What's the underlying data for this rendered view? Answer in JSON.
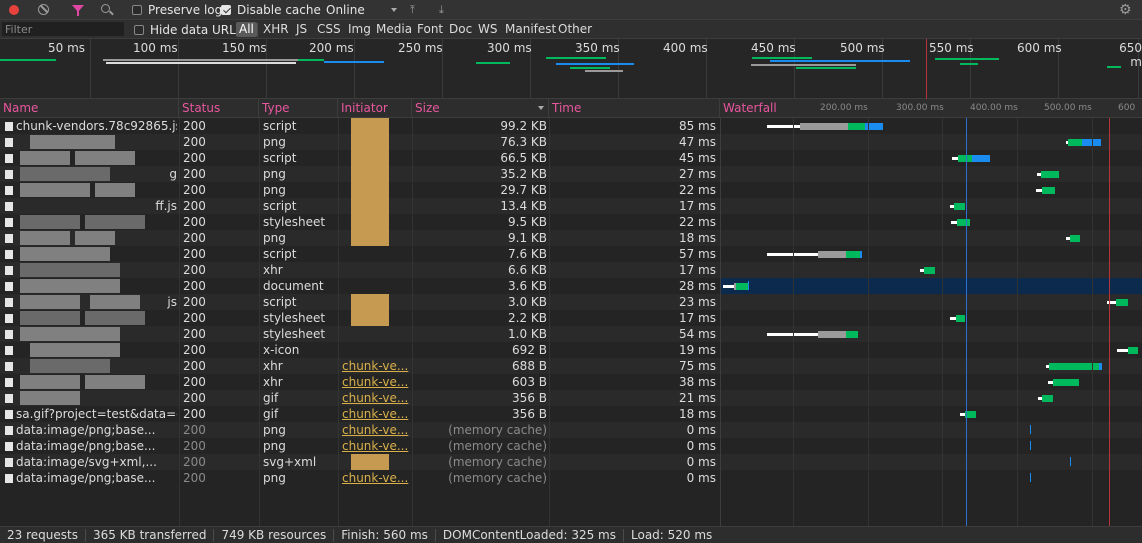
{
  "toolbar": {
    "preserve_log": "Preserve log",
    "disable_cache": "Disable cache",
    "throttle": "Online"
  },
  "filter": {
    "placeholder": "Filter",
    "hide_data_urls": "Hide data URLs",
    "types": [
      "All",
      "XHR",
      "JS",
      "CSS",
      "Img",
      "Media",
      "Font",
      "Doc",
      "WS",
      "Manifest",
      "Other"
    ]
  },
  "overview_ticks": [
    "50 ms",
    "100 ms",
    "150 ms",
    "200 ms",
    "250 ms",
    "300 ms",
    "350 ms",
    "400 ms",
    "450 ms",
    "500 ms",
    "550 ms",
    "600 ms",
    "650 m"
  ],
  "columns": {
    "name": "Name",
    "status": "Status",
    "type": "Type",
    "initiator": "Initiator",
    "size": "Size",
    "time": "Time",
    "waterfall": "Waterfall"
  },
  "waterfall_ticks": [
    "200.00 ms",
    "300.00 ms",
    "400.00 ms",
    "500.00 ms",
    "600"
  ],
  "requests": [
    {
      "name": "chunk-vendors.78c92865.js",
      "status": "200",
      "type": "script",
      "initiator": "",
      "size": "99.2 KB",
      "time": "85 ms"
    },
    {
      "name": "",
      "status": "200",
      "type": "png",
      "initiator": "",
      "size": "76.3 KB",
      "time": "47 ms"
    },
    {
      "name": "",
      "status": "200",
      "type": "script",
      "initiator": "",
      "size": "66.5 KB",
      "time": "45 ms"
    },
    {
      "name": "g",
      "status": "200",
      "type": "png",
      "initiator": "",
      "size": "35.2 KB",
      "time": "27 ms"
    },
    {
      "name": "",
      "status": "200",
      "type": "png",
      "initiator": "",
      "size": "29.7 KB",
      "time": "22 ms"
    },
    {
      "name": "ff.js",
      "status": "200",
      "type": "script",
      "initiator": "",
      "size": "13.4 KB",
      "time": "17 ms"
    },
    {
      "name": "",
      "status": "200",
      "type": "stylesheet",
      "initiator": "",
      "size": "9.5 KB",
      "time": "22 ms"
    },
    {
      "name": "",
      "status": "200",
      "type": "png",
      "initiator": "",
      "size": "9.1 KB",
      "time": "18 ms"
    },
    {
      "name": "",
      "status": "200",
      "type": "script",
      "initiator": "",
      "size": "7.6 KB",
      "time": "57 ms"
    },
    {
      "name": "",
      "status": "200",
      "type": "xhr",
      "initiator": "",
      "size": "6.6 KB",
      "time": "17 ms"
    },
    {
      "name": "",
      "status": "200",
      "type": "document",
      "initiator": "",
      "size": "3.6 KB",
      "time": "28 ms"
    },
    {
      "name": "js",
      "status": "200",
      "type": "script",
      "initiator": "",
      "size": "3.0 KB",
      "time": "23 ms"
    },
    {
      "name": "",
      "status": "200",
      "type": "stylesheet",
      "initiator": "",
      "size": "2.2 KB",
      "time": "17 ms"
    },
    {
      "name": "",
      "status": "200",
      "type": "stylesheet",
      "initiator": "",
      "size": "1.0 KB",
      "time": "54 ms"
    },
    {
      "name": "",
      "status": "200",
      "type": "x-icon",
      "initiator": "",
      "size": "692 B",
      "time": "19 ms"
    },
    {
      "name": "",
      "status": "200",
      "type": "xhr",
      "initiator": "chunk-ve...",
      "size": "688 B",
      "time": "75 ms"
    },
    {
      "name": "",
      "status": "200",
      "type": "xhr",
      "initiator": "chunk-ve...",
      "size": "603 B",
      "time": "38 ms"
    },
    {
      "name": "",
      "status": "200",
      "type": "gif",
      "initiator": "chunk-ve...",
      "size": "356 B",
      "time": "21 ms"
    },
    {
      "name": "sa.gif?project=test&data=e...",
      "status": "200",
      "type": "gif",
      "initiator": "chunk-ve...",
      "size": "356 B",
      "time": "18 ms"
    },
    {
      "name": "data:image/png;base...",
      "status": "200",
      "type": "png",
      "initiator": "chunk-ve...",
      "size": "(memory cache)",
      "time": "0 ms"
    },
    {
      "name": "data:image/png;base...",
      "status": "200",
      "type": "png",
      "initiator": "chunk-ve...",
      "size": "(memory cache)",
      "time": "0 ms"
    },
    {
      "name": "data:image/svg+xml,...",
      "status": "200",
      "type": "svg+xml",
      "initiator": "",
      "size": "(memory cache)",
      "time": "0 ms"
    },
    {
      "name": "data:image/png;base...",
      "status": "200",
      "type": "png",
      "initiator": "chunk-ve...",
      "size": "(memory cache)",
      "time": "0 ms"
    }
  ],
  "status_bar": {
    "requests": "23 requests",
    "transferred": "365 KB transferred",
    "resources": "749 KB resources",
    "finish": "Finish: 560 ms",
    "dcl": "DOMContentLoaded: 325 ms",
    "load": "Load: 520 ms"
  },
  "colors": {
    "accent_pink": "#e8569e",
    "waiting": "#00b95c",
    "download": "#1a8cf0",
    "queue": "#ffffff",
    "stalled": "#9a9a9a",
    "dcl_line": "#2e6fd0",
    "load_line": "#b3343a"
  }
}
